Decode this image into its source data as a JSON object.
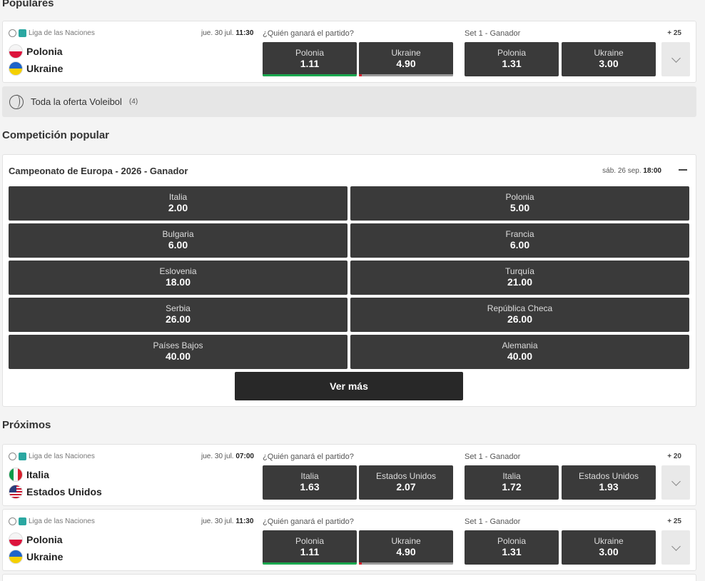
{
  "sections": {
    "popular": "Populares",
    "competition": "Competición popular",
    "upcoming": "Próximos"
  },
  "popular_events": [
    {
      "league": "Liga de las Naciones",
      "date_prefix": "jue. 30 jul.",
      "time": "11:30",
      "home": "Polonia",
      "away": "Ukraine",
      "market1_label": "¿Quién ganará el partido?",
      "market1_home_name": "Polonia",
      "market1_home_odd": "1.11",
      "market1_away_name": "Ukraine",
      "market1_away_odd": "4.90",
      "market2_label": "Set 1 - Ganador",
      "market2_home_name": "Polonia",
      "market2_home_odd": "1.31",
      "market2_away_name": "Ukraine",
      "market2_away_odd": "3.00",
      "more_markets": "+ 25"
    }
  ],
  "all_offer": {
    "label": "Toda la oferta Voleibol",
    "count": "(4)"
  },
  "competition": {
    "title": "Campeonato de Europa - 2026 - Ganador",
    "date_prefix": "sáb. 26 sep.",
    "time": "18:00",
    "outcomes": [
      {
        "name": "Italia",
        "odd": "2.00"
      },
      {
        "name": "Polonia",
        "odd": "5.00"
      },
      {
        "name": "Bulgaria",
        "odd": "6.00"
      },
      {
        "name": "Francia",
        "odd": "6.00"
      },
      {
        "name": "Eslovenia",
        "odd": "18.00"
      },
      {
        "name": "Turquía",
        "odd": "21.00"
      },
      {
        "name": "Serbia",
        "odd": "26.00"
      },
      {
        "name": "República Checa",
        "odd": "26.00"
      },
      {
        "name": "Países Bajos",
        "odd": "40.00"
      },
      {
        "name": "Alemania",
        "odd": "40.00"
      }
    ],
    "see_more": "Ver más"
  },
  "upcoming_events": [
    {
      "league": "Liga de las Naciones",
      "date_prefix": "jue. 30 jul.",
      "time": "07:00",
      "home": "Italia",
      "away": "Estados Unidos",
      "market1_label": "¿Quién ganará el partido?",
      "market1_home_name": "Italia",
      "market1_home_odd": "1.63",
      "market1_away_name": "Estados Unidos",
      "market1_away_odd": "2.07",
      "market2_label": "Set 1 - Ganador",
      "market2_home_name": "Italia",
      "market2_home_odd": "1.72",
      "market2_away_name": "Estados Unidos",
      "market2_away_odd": "1.93",
      "more_markets": "+ 20"
    },
    {
      "league": "Liga de las Naciones",
      "date_prefix": "jue. 30 jul.",
      "time": "11:30",
      "home": "Polonia",
      "away": "Ukraine",
      "market1_label": "¿Quién ganará el partido?",
      "market1_home_name": "Polonia",
      "market1_home_odd": "1.11",
      "market1_away_name": "Ukraine",
      "market1_away_odd": "4.90",
      "market2_label": "Set 1 - Ganador",
      "market2_home_name": "Polonia",
      "market2_home_odd": "1.31",
      "market2_away_name": "Ukraine",
      "market2_away_odd": "3.00",
      "more_markets": "+ 25"
    }
  ]
}
